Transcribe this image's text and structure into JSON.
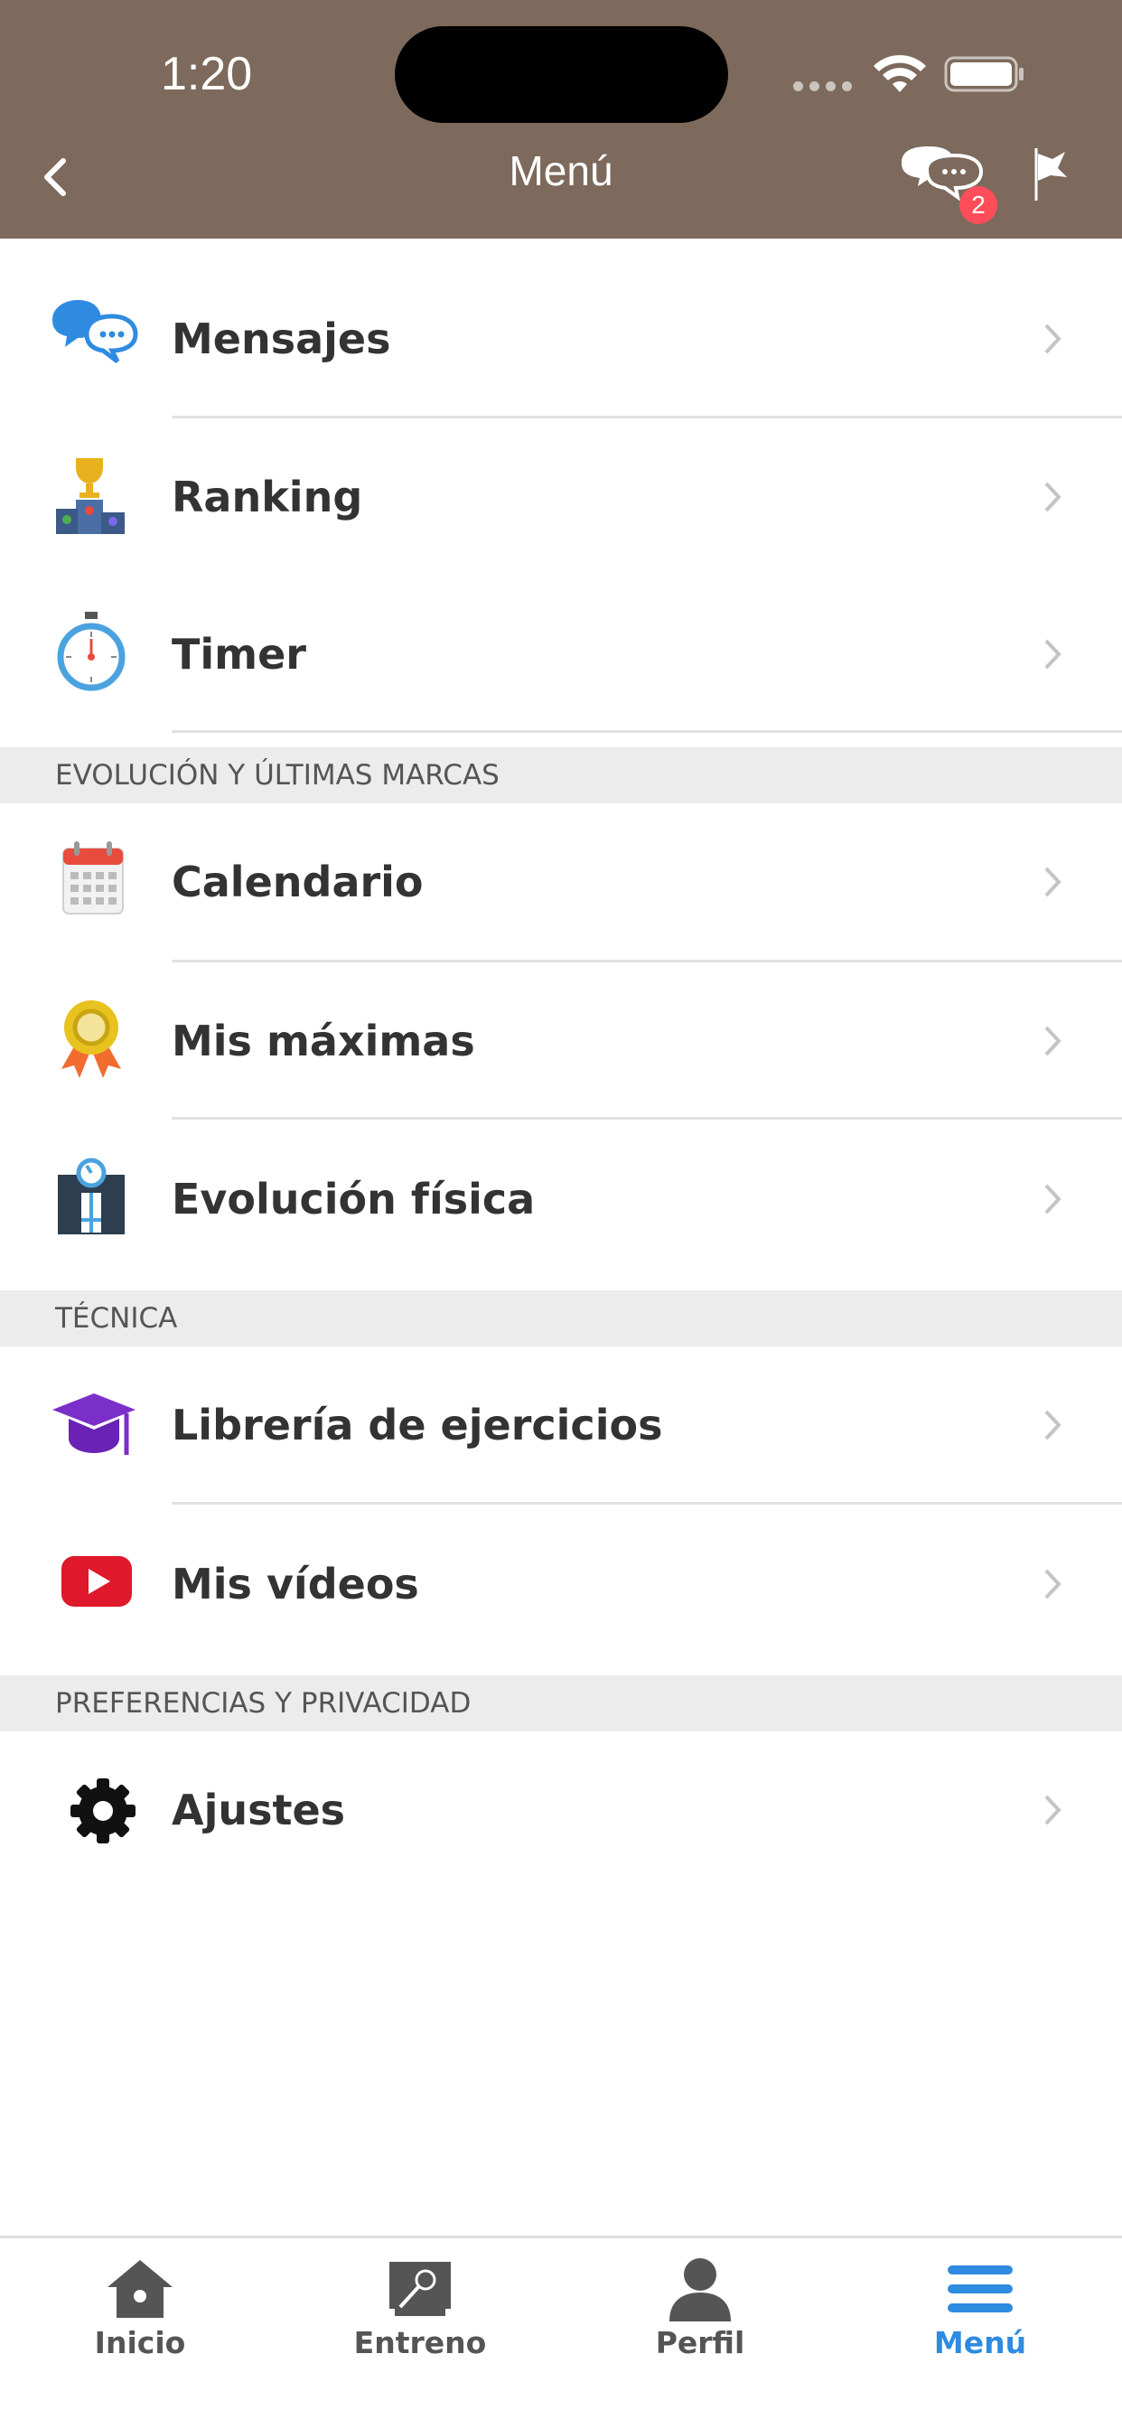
{
  "status_bar": {
    "time": "1:20"
  },
  "nav": {
    "title": "Menú",
    "chat_badge": "2"
  },
  "menu": {
    "group1": [
      {
        "label": "Mensajes",
        "icon": "messages-icon"
      },
      {
        "label": "Ranking",
        "icon": "podium-icon"
      },
      {
        "label": "Timer",
        "icon": "stopwatch-icon"
      }
    ],
    "section2": "EVOLUCIÓN Y ÚLTIMAS MARCAS",
    "group2": [
      {
        "label": "Calendario",
        "icon": "calendar-icon"
      },
      {
        "label": "Mis máximas",
        "icon": "medal-icon"
      },
      {
        "label": "Evolución física",
        "icon": "scale-icon"
      }
    ],
    "section3": "TÉCNICA",
    "group3": [
      {
        "label": "Librería de ejercicios",
        "icon": "graduation-cap-icon"
      },
      {
        "label": "Mis vídeos",
        "icon": "youtube-icon"
      }
    ],
    "section4": "PREFERENCIAS Y PRIVACIDAD",
    "group4": [
      {
        "label": "Ajustes",
        "icon": "gear-icon"
      }
    ]
  },
  "tabs": [
    {
      "label": "Inicio",
      "icon": "home-icon",
      "active": false
    },
    {
      "label": "Entreno",
      "icon": "training-icon",
      "active": false
    },
    {
      "label": "Perfil",
      "icon": "person-icon",
      "active": false
    },
    {
      "label": "Menú",
      "icon": "hamburger-icon",
      "active": true
    }
  ],
  "colors": {
    "header": "#7d6a5c",
    "accent": "#2f8be0",
    "badge": "#ff4d5a",
    "section_bg": "#ececec"
  }
}
